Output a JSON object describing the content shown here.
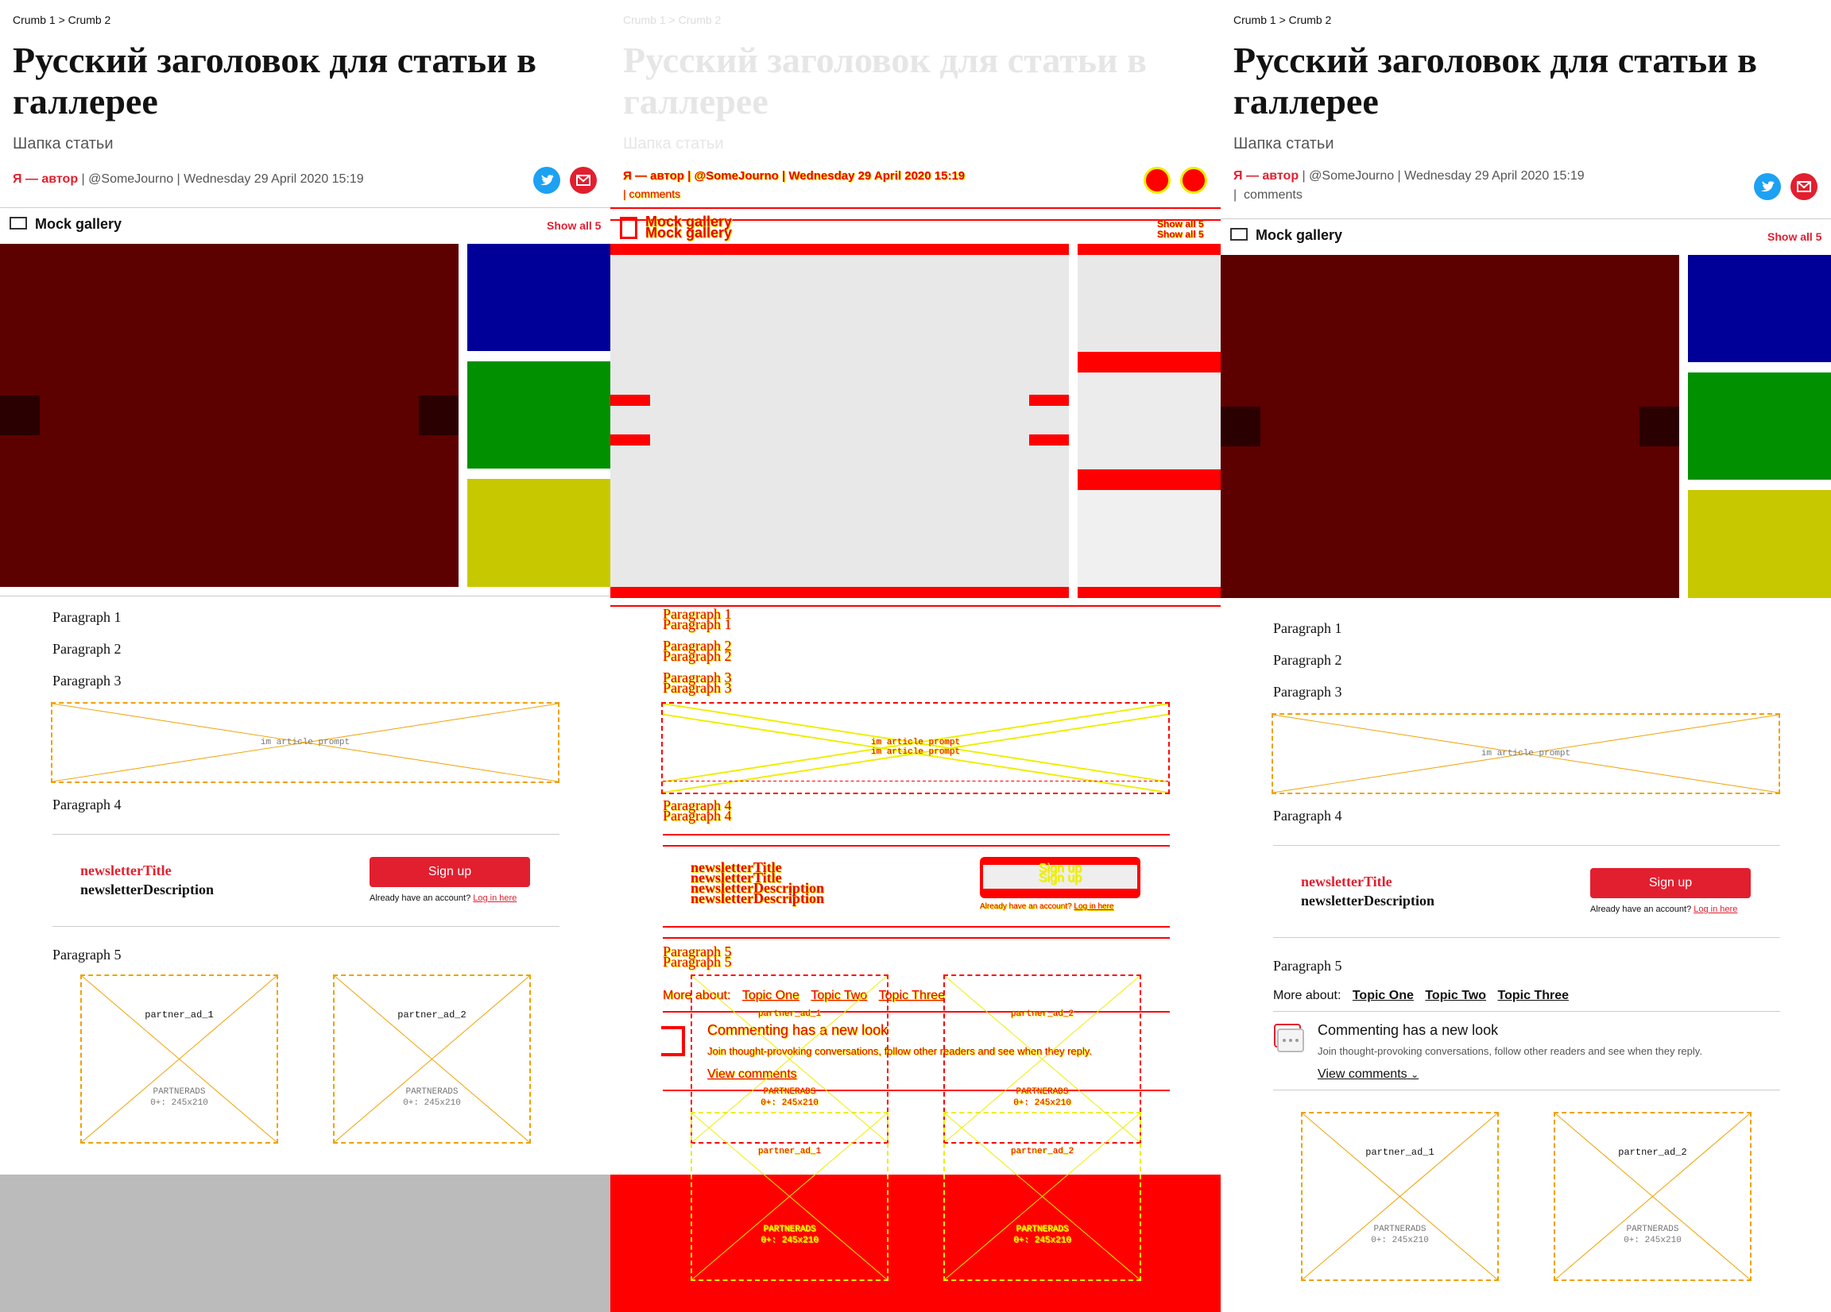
{
  "article": {
    "breadcrumbs": [
      "Crumb 1",
      "Crumb 2"
    ],
    "crumb_sep": ">",
    "title": "Русский заголовок для статьи в галлерее",
    "standfirst": "Шапка статьи",
    "author": "Я — автор",
    "byline_rest": "| @SomeJourno | Wednesday 29 April 2020 15:19",
    "comments_label": "comments",
    "gallery": {
      "title": "Mock gallery",
      "show_all": "Show all 5",
      "colors": [
        "#5c0000",
        "#000099",
        "#009000",
        "#c8c800"
      ]
    },
    "paragraphs": [
      "Paragraph 1",
      "Paragraph 2",
      "Paragraph 3",
      "Paragraph 4",
      "Paragraph 5"
    ],
    "prompt_label": "im article prompt",
    "newsletter": {
      "title": "newsletterTitle",
      "description": "newsletterDescription",
      "signup": "Sign up",
      "already": "Already have an account?",
      "login": "Log in here"
    },
    "more_about": {
      "label": "More about:",
      "topics": [
        "Topic One",
        "Topic Two",
        "Topic Three"
      ]
    },
    "commenting": {
      "title": "Commenting has a new look",
      "subtitle": "Join thought-provoking conversations, follow other readers and see when they reply.",
      "link": "View comments"
    },
    "ads": [
      {
        "name": "partner_ad_1",
        "line1": "PARTNERADS",
        "line2": "0+: 245x210"
      },
      {
        "name": "partner_ad_2",
        "line1": "PARTNERADS",
        "line2": "0+: 245x210"
      }
    ]
  },
  "colors": {
    "accent": "#e21f2f",
    "twitter": "#1da1f2",
    "placeholder_border": "#f0a000",
    "footer_grey": "#bbbbbb",
    "diff_red": "#ff0000"
  }
}
